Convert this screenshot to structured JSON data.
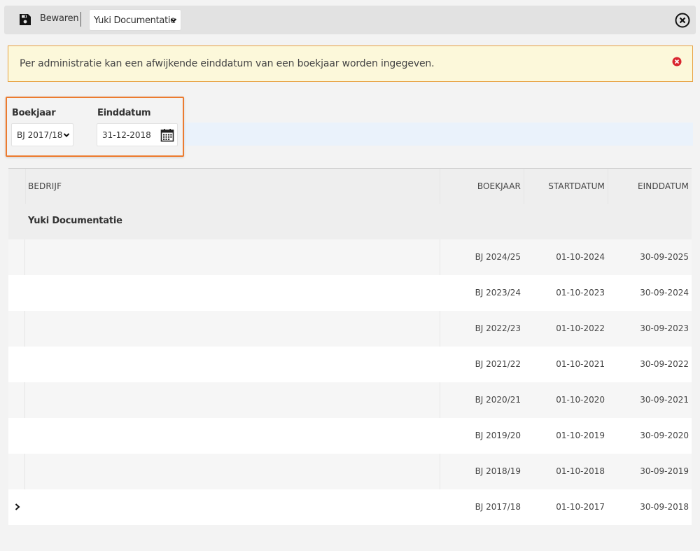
{
  "toolbar": {
    "save_label": "Bewaren",
    "company_select": "Yuki Documentatie"
  },
  "alert": {
    "message": "Per administratie kan een afwijkende einddatum van een boekjaar worden ingegeven."
  },
  "filter": {
    "boekjaar_label": "Boekjaar",
    "boekjaar_value": "BJ 2017/18",
    "einddatum_label": "Einddatum",
    "einddatum_value": "31-12-2018"
  },
  "grid": {
    "columns": [
      "BEDRIJF",
      "BOEKJAAR",
      "STARTDATUM",
      "EINDDATUM"
    ],
    "group": "Yuki Documentatie",
    "rows": [
      {
        "boekjaar": "BJ 2024/25",
        "start": "01-10-2024",
        "eind": "30-09-2025"
      },
      {
        "boekjaar": "BJ 2023/24",
        "start": "01-10-2023",
        "eind": "30-09-2024"
      },
      {
        "boekjaar": "BJ 2022/23",
        "start": "01-10-2022",
        "eind": "30-09-2023"
      },
      {
        "boekjaar": "BJ 2021/22",
        "start": "01-10-2021",
        "eind": "30-09-2022"
      },
      {
        "boekjaar": "BJ 2020/21",
        "start": "01-10-2020",
        "eind": "30-09-2021"
      },
      {
        "boekjaar": "BJ 2019/20",
        "start": "01-10-2019",
        "eind": "30-09-2020"
      },
      {
        "boekjaar": "BJ 2018/19",
        "start": "01-10-2018",
        "eind": "30-09-2019"
      },
      {
        "boekjaar": "BJ 2017/18",
        "start": "01-10-2017",
        "eind": "30-09-2018"
      }
    ]
  },
  "colors": {
    "alert_bg": "#fcf8da",
    "alert_border": "#e7a040",
    "highlight_border": "#ec7b2f",
    "error_icon": "#d9262f"
  },
  "icons": [
    "save-icon",
    "chevron-down-icon",
    "close-circle-icon",
    "error-close-icon",
    "calendar-icon",
    "chevron-right-icon"
  ]
}
